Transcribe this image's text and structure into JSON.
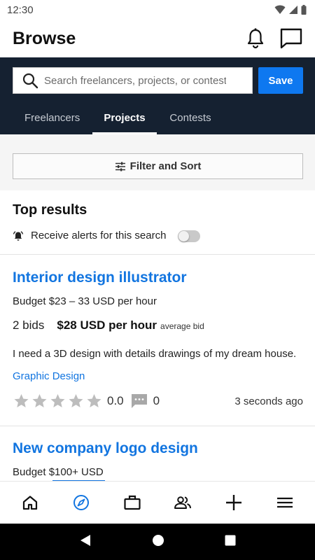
{
  "status_bar": {
    "time": "12:30"
  },
  "header": {
    "title": "Browse",
    "notification_icon": "bell-icon",
    "messages_icon": "chat-bubble-icon"
  },
  "search": {
    "placeholder": "Search freelancers, projects, or contests",
    "value": "",
    "save_label": "Save"
  },
  "tabs": [
    {
      "label": "Freelancers",
      "active": false
    },
    {
      "label": "Projects",
      "active": true
    },
    {
      "label": "Contests",
      "active": false
    }
  ],
  "filter": {
    "label": "Filter and Sort",
    "icon": "sliders-icon"
  },
  "results": {
    "heading": "Top results",
    "alert_label": "Receive alerts for this search",
    "alert_enabled": false,
    "projects": [
      {
        "title": "Interior design illustrator",
        "budget": "Budget $23 – 33 USD per hour",
        "bids": "2 bids",
        "avg_price": "$28 USD per hour",
        "avg_label": "average bid",
        "description": "I need a 3D design with details drawings of my dream house.",
        "skill": "Graphic Design",
        "rating": "0.0",
        "stars": 0,
        "comments": "0",
        "posted": "3 seconds ago"
      },
      {
        "title": "New company logo design",
        "budget": "Budget $100+ USD"
      }
    ]
  },
  "bottom_nav": [
    {
      "icon": "home-icon",
      "active": false
    },
    {
      "icon": "compass-icon",
      "active": true
    },
    {
      "icon": "briefcase-icon",
      "active": false
    },
    {
      "icon": "people-icon",
      "active": false
    },
    {
      "icon": "plus-icon",
      "active": false
    },
    {
      "icon": "menu-icon",
      "active": false
    }
  ],
  "colors": {
    "accent": "#0e78f0",
    "link": "#1275e0",
    "band": "#152131"
  }
}
